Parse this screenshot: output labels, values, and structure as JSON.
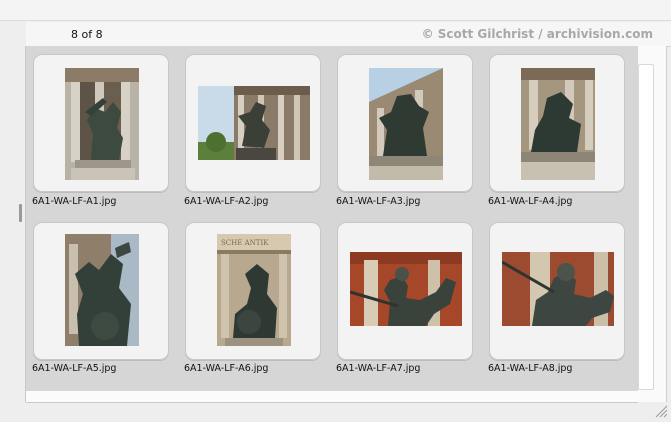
{
  "header": {
    "count": "8 of 8",
    "credit": "© Scott Gilchrist / archivision.com"
  },
  "thumbnails": [
    {
      "filename": "6A1-WA-LF-A1.jpg"
    },
    {
      "filename": "6A1-WA-LF-A2.jpg"
    },
    {
      "filename": "6A1-WA-LF-A3.jpg"
    },
    {
      "filename": "6A1-WA-LF-A4.jpg"
    },
    {
      "filename": "6A1-WA-LF-A5.jpg"
    },
    {
      "filename": "6A1-WA-LF-A6.jpg"
    },
    {
      "filename": "6A1-WA-LF-A7.jpg"
    },
    {
      "filename": "6A1-WA-LF-A8.jpg"
    }
  ],
  "photo6_inscription": "SCHE ANTIK"
}
